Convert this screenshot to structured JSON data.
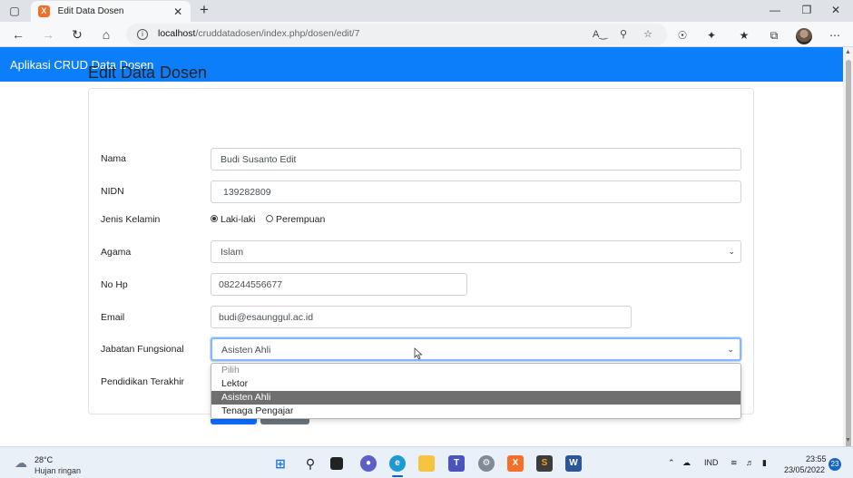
{
  "browser": {
    "tab_title": "Edit Data Dosen",
    "tab_favicon_glyph": "X",
    "url_host": "localhost",
    "url_path": "/cruddatadosen/index.php/dosen/edit/7"
  },
  "app": {
    "brand": "Aplikasi CRUD Data Dosen",
    "page_title": "Edit Data Dosen"
  },
  "form": {
    "nama": {
      "label": "Nama",
      "value": "Budi Susanto Edit"
    },
    "nidn": {
      "label": "NIDN",
      "value": "139282809"
    },
    "jenis_kelamin": {
      "label": "Jenis Kelamin",
      "options": [
        "Laki-laki",
        "Perempuan"
      ],
      "selected": "Laki-laki"
    },
    "agama": {
      "label": "Agama",
      "value": "Islam"
    },
    "no_hp": {
      "label": "No Hp",
      "value": "082244556677"
    },
    "email": {
      "label": "Email",
      "value": "budi@esaunggul.ac.id"
    },
    "jabatan": {
      "label": "Jabatan Fungsional",
      "value": "Asisten Ahli",
      "options": [
        "Pilih",
        "Lektor",
        "Asisten Ahli",
        "Tenaga Pengajar"
      ]
    },
    "pendidikan": {
      "label": "Pendidikan Terakhir"
    }
  },
  "colors": {
    "navbar": "#0d7ef9",
    "primary_button": "#0d6efd",
    "secondary_button": "#6c757d",
    "selected_option": "#6f6f6f"
  },
  "taskbar": {
    "weather_temp": "28°C",
    "weather_desc": "Hujan ringan",
    "language": "IND",
    "time": "23:55",
    "date": "23/05/2022",
    "notification_count": "23"
  }
}
